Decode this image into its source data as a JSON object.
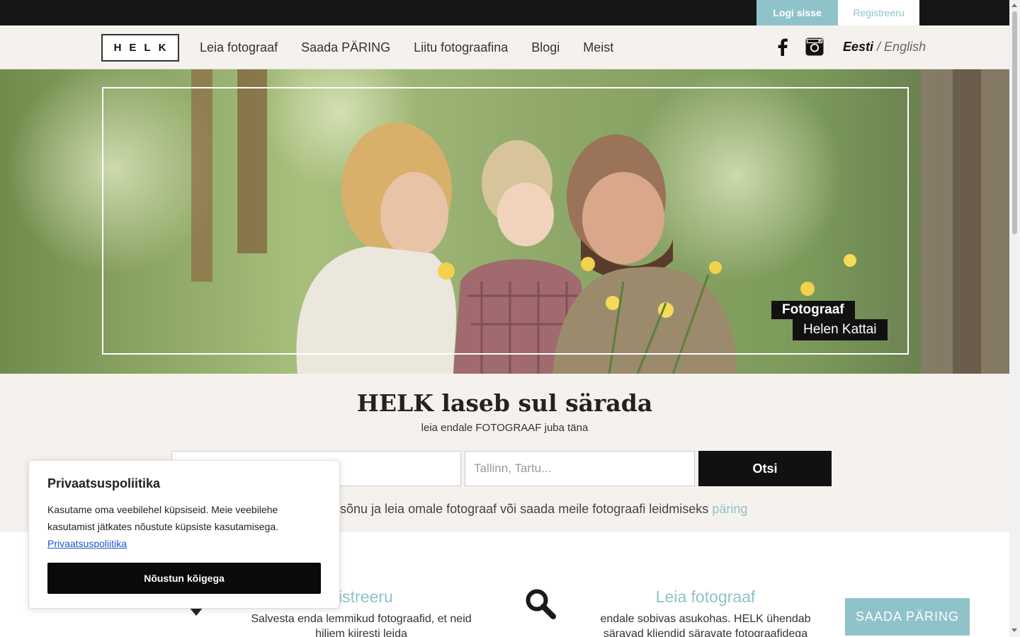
{
  "topbar": {
    "login": "Logi sisse",
    "register": "Registreeru"
  },
  "nav": {
    "logo": "HELK",
    "links": [
      "Leia fotograaf",
      "Saada PÄRING",
      "Liitu fotograafina",
      "Blogi",
      "Meist"
    ],
    "social_icons": [
      "facebook-icon",
      "instagram-icon"
    ],
    "lang_active": "Eesti",
    "lang_separator": " / ",
    "lang_other": "English"
  },
  "hero": {
    "credit_title": "Fotograaf",
    "credit_name": "Helen Kattai"
  },
  "search": {
    "headline": "HELK laseb sul särada",
    "subline": "leia endale FOTOGRAAF juba täna",
    "keyword_value": "",
    "location_placeholder": "Tallinn, Tartu...",
    "button": "Otsi",
    "hint_text": "sõnu ja leia omale fotograaf või saada meile fotograafi leidmiseks",
    "hint_link": "päring"
  },
  "features": {
    "left": {
      "title": "gistreeru",
      "desc": "Salvesta enda lemmikud fotograafid, et neid hiljem kiiresti leida"
    },
    "right": {
      "title": "Leia fotograaf",
      "desc": "endale sobivas asukohas. HELK ühendab säravad kliendid säravate fotograafidega"
    }
  },
  "float_button": "SAADA PÄRING",
  "cookie": {
    "title": "Privaatsuspoliitika",
    "text": "Kasutame oma veebilehel küpsiseid. Meie veebilehe kasutamist jätkates nõustute küpsiste kasutamisega.",
    "link": "Privaatsuspoliitika",
    "button": "Nõustun kõigega"
  },
  "colors": {
    "accent": "#8fc3c9",
    "dark": "#111111",
    "band": "#f5f2ee"
  }
}
